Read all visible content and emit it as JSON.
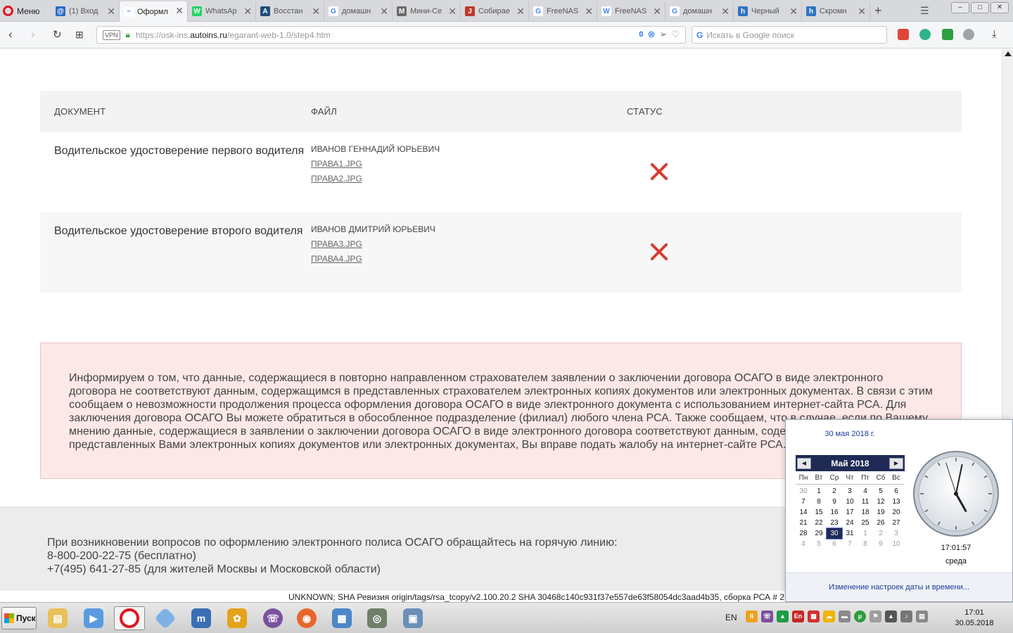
{
  "browser": {
    "menu_label": "Меню",
    "tabs": [
      {
        "title": "(1) Вход",
        "color": "#2a6cc6",
        "glyph": "@"
      },
      {
        "title": "Оформл",
        "color": "#ffffff",
        "glyph": "~",
        "active": true
      },
      {
        "title": "WhatsAp",
        "color": "#25d366",
        "glyph": "W"
      },
      {
        "title": "Восстан",
        "color": "#1f4e79",
        "glyph": "A"
      },
      {
        "title": "домашн",
        "color": "#ffffff",
        "glyph": "G"
      },
      {
        "title": "Мини-Се",
        "color": "#6b6b6b",
        "glyph": "M"
      },
      {
        "title": "Собирае",
        "color": "#c0392b",
        "glyph": "J"
      },
      {
        "title": "FreeNAS",
        "color": "#ffffff",
        "glyph": "G"
      },
      {
        "title": "FreeNAS",
        "color": "#ffffff",
        "glyph": "W"
      },
      {
        "title": "домашн",
        "color": "#ffffff",
        "glyph": "G"
      },
      {
        "title": "Черный",
        "color": "#2f74c0",
        "glyph": "h"
      },
      {
        "title": "Скромн",
        "color": "#2f74c0",
        "glyph": "h"
      }
    ],
    "url_prefix": "https://osk-ins.",
    "url_domain": "autoins.ru",
    "url_path": "/egarant-web-1.0/step4.htm",
    "vpn_label": "VPN",
    "adblock_count": "0",
    "search_placeholder": "Искать в Google поиск"
  },
  "table": {
    "headers": {
      "document": "ДОКУМЕНТ",
      "file": "ФАЙЛ",
      "status": "СТАТУС"
    },
    "rows": [
      {
        "document": "Водительское удостоверение первого водителя",
        "owner": "ИВАНОВ ГЕННАДИЙ ЮРЬЕВИЧ",
        "files": [
          "ПРАВА1.JPG",
          "ПРАВА2.JPG"
        ],
        "status": "rejected",
        "status_color": "#d93b30"
      },
      {
        "document": "Водительское удостоверение второго водителя",
        "owner": "ИВАНОВ ДМИТРИЙ ЮРЬЕВИЧ",
        "files": [
          "ПРАВА3.JPG",
          "ПРАВА4.JPG"
        ],
        "status": "rejected",
        "status_color": "#d93b30"
      }
    ]
  },
  "alert": {
    "text": "Информируем о том, что данные, содержащиеся в повторно направленном страхователем заявлении о заключении договора ОСАГО в виде электронного договора не соответствуют данным, содержащимся в представленных страхователем электронных копиях документов или электронных документах. В связи с этим сообщаем о невозможности продолжения процесса оформления договора ОСАГО в виде электронного документа с использованием интернет-сайта РСА. Для заключения договора ОСАГО Вы можете обратиться в обособленное подразделение (филиал) любого члена РСА. Также сообщаем, что в случае, если по Вашему мнению данные, содержащиеся в заявлении о заключении договора ОСАГО в виде электронного договора соответствуют данным, содержащимся в представленных Вами электронных копиях документов или электронных документах, Вы вправе подать жалобу на интернет-сайте РСА.",
    "bg_color": "#fde8e8"
  },
  "footer": {
    "line1": "При возникновении вопросов по оформлению электронного полиса ОСАГО обращайтесь на горячую линию:",
    "line2": "8-800-200-22-75 (бесплатно)",
    "line3": "+7(495) 641-27-85 (для жителей Москвы и Московской области)"
  },
  "build_info": "UNKNOWN; SHA Ревизия origin/tags/rsa_tcopy/v2.100.20.2 SHA 30468c140c931f37e557de63f58054dc3aad4b35, сборка РСА # 2",
  "calendar": {
    "full_date": "30 мая 2018 г.",
    "month_label": "Май 2018",
    "weekdays": [
      "Пн",
      "Вт",
      "Ср",
      "Чт",
      "Пт",
      "Сб",
      "Вс"
    ],
    "weeks": [
      [
        "30",
        "1",
        "2",
        "3",
        "4",
        "5",
        "6"
      ],
      [
        "7",
        "8",
        "9",
        "10",
        "11",
        "12",
        "13"
      ],
      [
        "14",
        "15",
        "16",
        "17",
        "18",
        "19",
        "20"
      ],
      [
        "21",
        "22",
        "23",
        "24",
        "25",
        "26",
        "27"
      ],
      [
        "28",
        "29",
        "30",
        "31",
        "1",
        "2",
        "3"
      ],
      [
        "4",
        "5",
        "6",
        "7",
        "8",
        "9",
        "10"
      ]
    ],
    "today": "30",
    "time": "17:01:57",
    "weekday_name": "среда",
    "settings_link": "Изменение настроек даты и времени..."
  },
  "taskbar": {
    "start_label": "Пуск",
    "language": "EN",
    "clock_time": "17:01",
    "clock_date": "30.05.2018"
  }
}
